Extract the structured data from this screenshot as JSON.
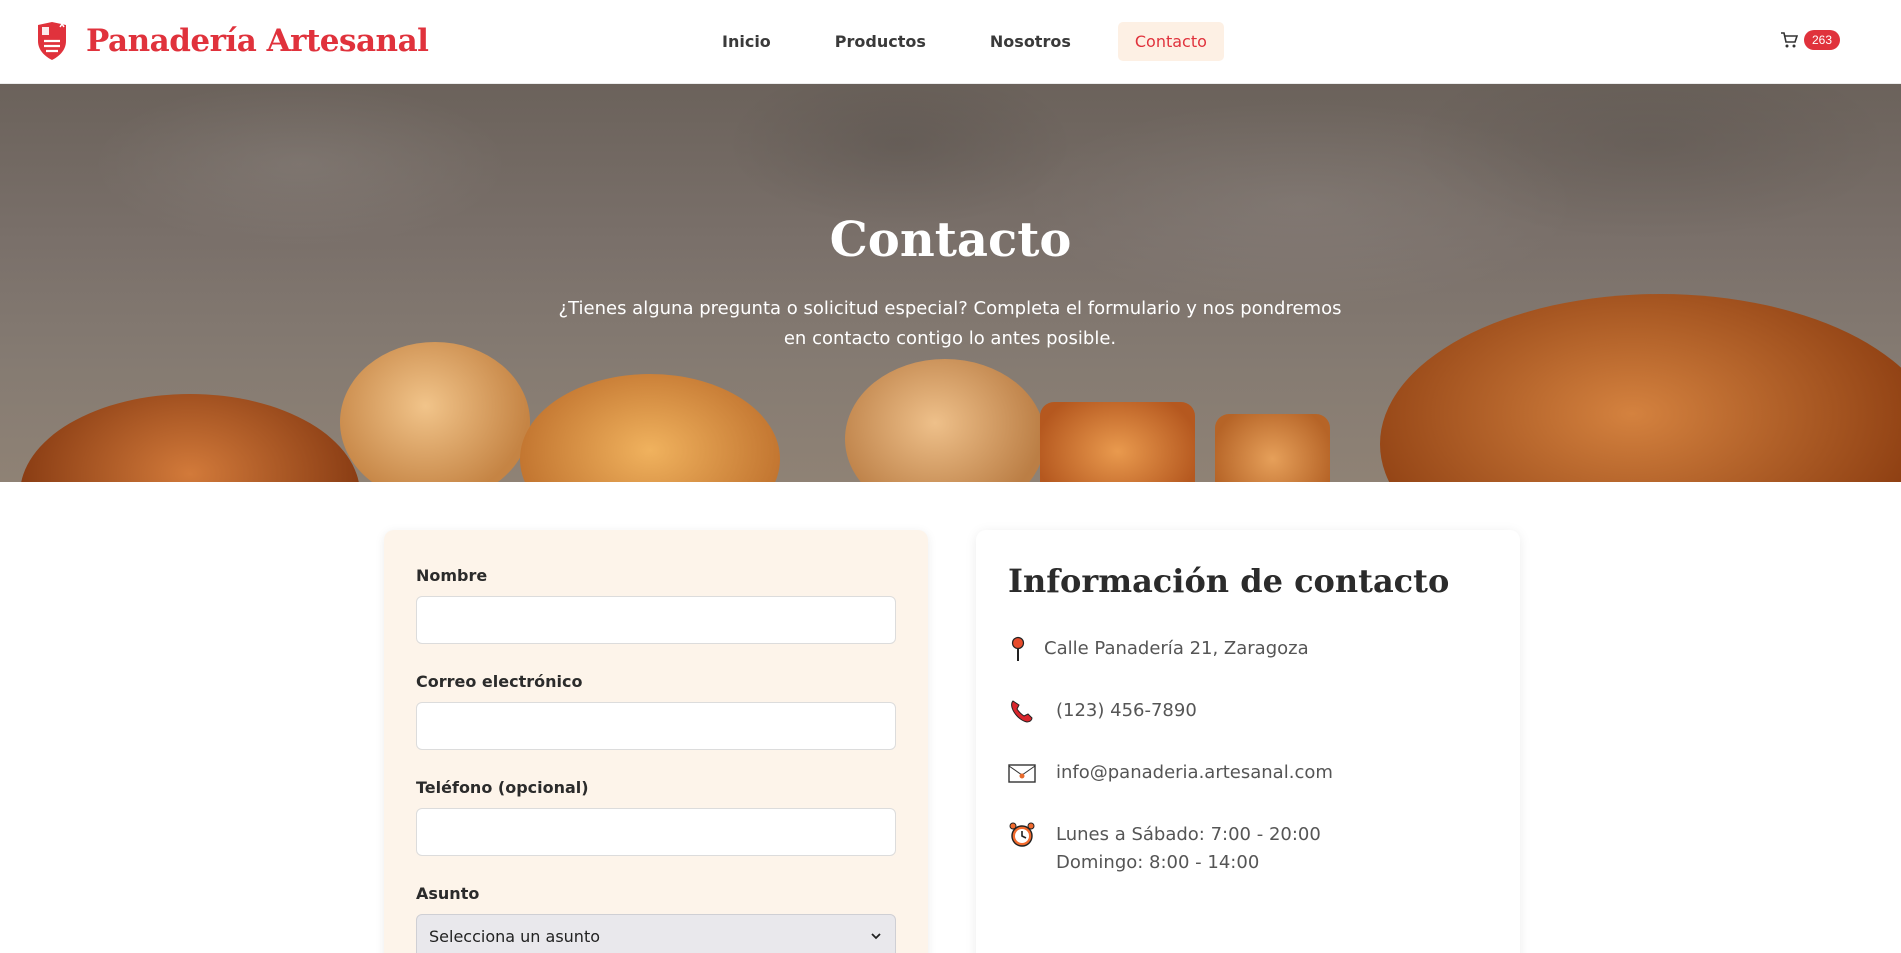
{
  "brand": {
    "name": "Panadería Artesanal",
    "logo_icon": "shield-flag-icon"
  },
  "nav": {
    "items": [
      {
        "label": "Inicio",
        "active": false
      },
      {
        "label": "Productos",
        "active": false
      },
      {
        "label": "Nosotros",
        "active": false
      },
      {
        "label": "Contacto",
        "active": true
      }
    ]
  },
  "cart": {
    "icon": "cart-icon",
    "count": "263"
  },
  "hero": {
    "title": "Contacto",
    "subtitle": "¿Tienes alguna pregunta o solicitud especial? Completa el formulario y nos pondremos en contacto contigo lo antes posible."
  },
  "form": {
    "fields": [
      {
        "label": "Nombre",
        "value": ""
      },
      {
        "label": "Correo electrónico",
        "value": ""
      },
      {
        "label": "Teléfono (opcional)",
        "value": ""
      }
    ],
    "subject": {
      "label": "Asunto",
      "selected": "Selecciona un asunto"
    }
  },
  "info": {
    "title": "Información de contacto",
    "address": {
      "icon": "location-pin-icon",
      "text": "Calle Panadería 21, Zaragoza"
    },
    "phone": {
      "icon": "phone-icon",
      "text": "(123) 456-7890"
    },
    "email": {
      "icon": "envelope-icon",
      "text": "info@panaderia.artesanal.com"
    },
    "hours": {
      "icon": "alarm-clock-icon",
      "line1": "Lunes a Sábado: 7:00 - 20:00",
      "line2": "Domingo: 8:00 - 14:00"
    }
  },
  "colors": {
    "brand": "#e0323c",
    "form_bg": "#fdf4ea",
    "nav_active_bg": "#fdf0e4"
  }
}
